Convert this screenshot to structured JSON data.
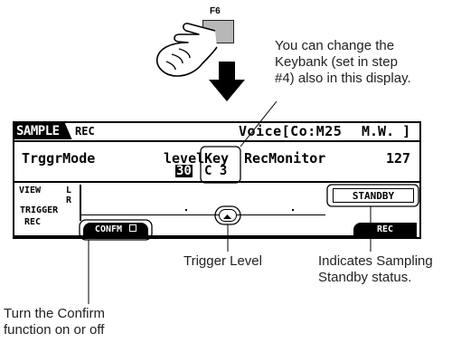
{
  "key": {
    "label": "F6"
  },
  "callouts": {
    "keybank": [
      "You can change the",
      "Keybank (set in step",
      "#4) also in this display."
    ],
    "trigger_level": "Trigger Level",
    "standby": [
      "Indicates Sampling",
      "Standby status."
    ],
    "confirm": [
      "Turn the Confirm",
      "function on or off"
    ]
  },
  "lcd": {
    "tab_sample": "SAMPLE",
    "tab_rec": "REC",
    "voice": "Voice[Co:M25",
    "voice_suffix": "M.W. ]",
    "trigger_mode_label": "TrggrMode",
    "level_label": "level",
    "level_value": "30",
    "key_label": "Key",
    "key_value": "C 3",
    "rec_monitor_label": "RecMonitor",
    "rec_monitor_value": "127",
    "view_label": "VIEW",
    "channel_l": "L",
    "channel_r": "R",
    "trigger_label": "TRIGGER",
    "rec_bottom_label": "REC",
    "standby_label": "STANDBY",
    "confirm_label": "CONFM",
    "rec_button": "REC"
  }
}
